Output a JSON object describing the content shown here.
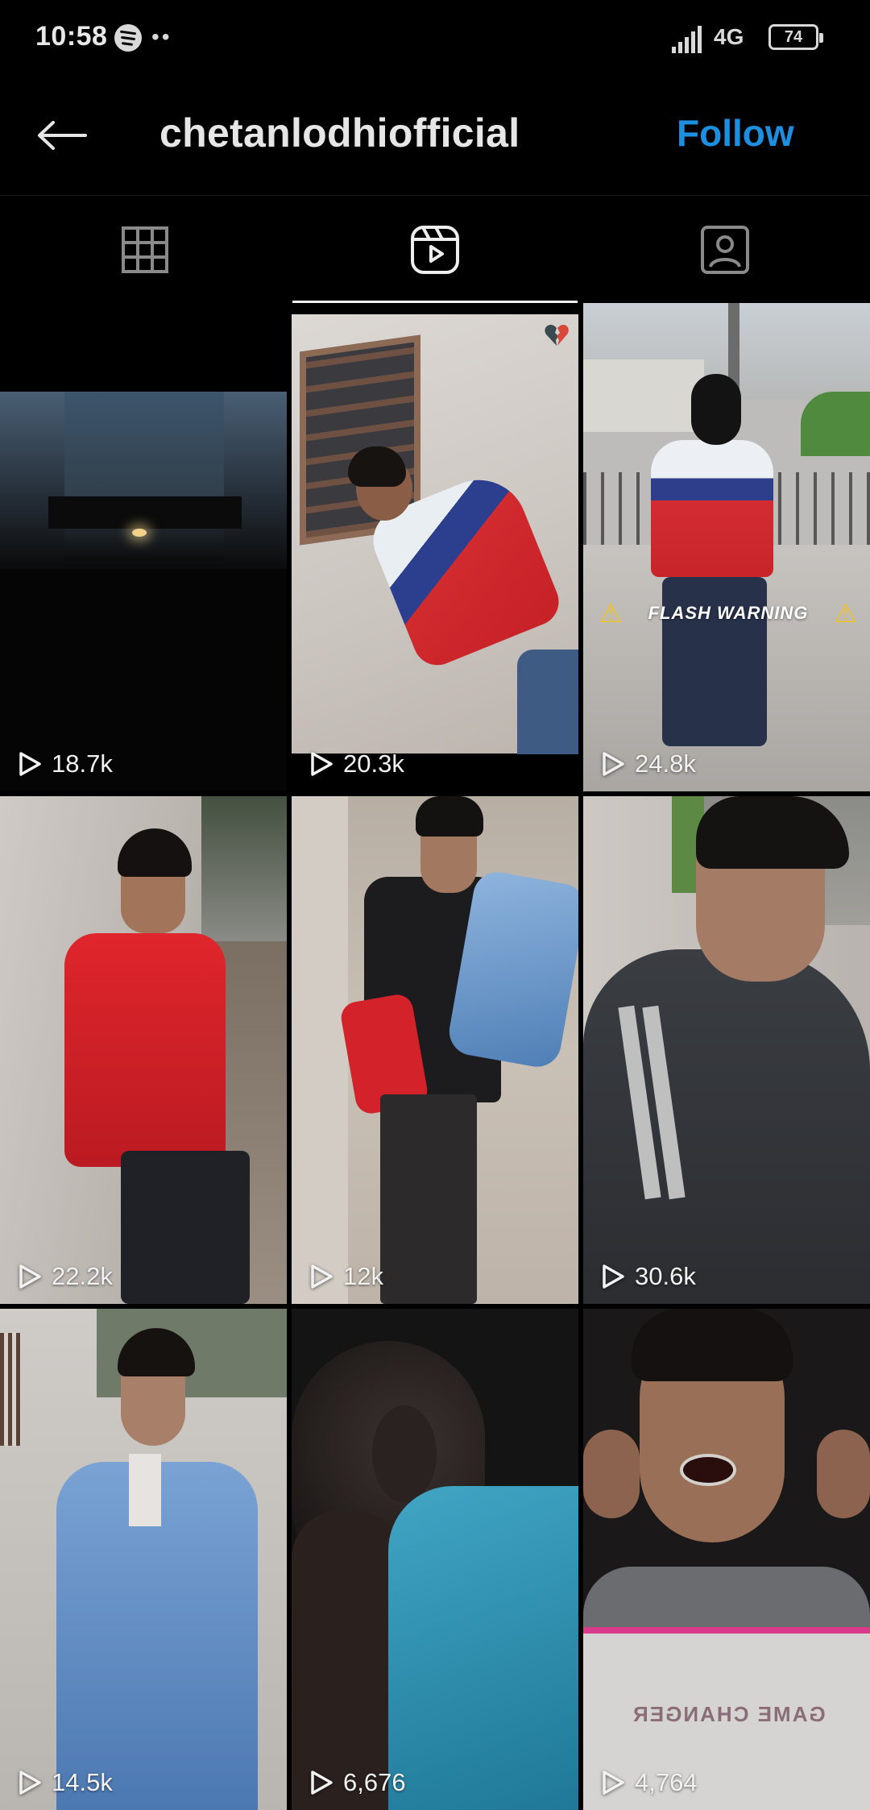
{
  "status_bar": {
    "time": "10:58",
    "network": "4G",
    "battery": "74",
    "icons": [
      "spotify-icon",
      "more-dots-icon",
      "signal-icon",
      "battery-icon"
    ]
  },
  "header": {
    "back_icon": "arrow-left-icon",
    "username": "chetanlodhiofficial",
    "follow_label": "Follow"
  },
  "tabs": [
    {
      "icon": "grid-icon",
      "active": false
    },
    {
      "icon": "reels-icon",
      "active": true
    },
    {
      "icon": "tagged-icon",
      "active": false
    }
  ],
  "colors": {
    "accent": "#1d8fe1",
    "background": "#000000"
  },
  "reels": [
    {
      "plays": "18.7k"
    },
    {
      "plays": "20.3k",
      "overlay": "broken-heart-icon"
    },
    {
      "plays": "24.8k",
      "caption": "FLASH WARNING"
    },
    {
      "plays": "22.2k"
    },
    {
      "plays": "12k"
    },
    {
      "plays": "30.6k"
    },
    {
      "plays": "14.5k"
    },
    {
      "plays": "6,676"
    },
    {
      "plays": "4,764"
    }
  ]
}
